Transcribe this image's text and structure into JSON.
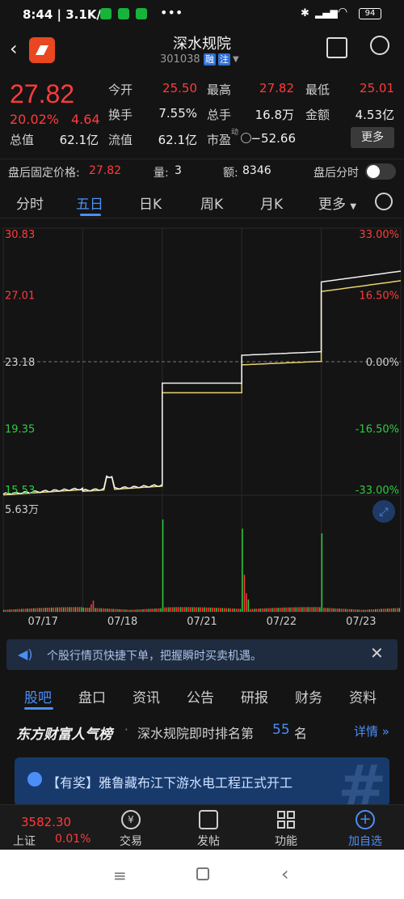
{
  "status": {
    "time": "8:44",
    "speed": "3.1K/s",
    "battery": "94"
  },
  "header": {
    "name": "深水规院",
    "code": "301038",
    "tag1": "融",
    "tag2": "注"
  },
  "quote": {
    "price": "27.82",
    "change_pct": "20.02%",
    "change": "4.64",
    "open_label": "今开",
    "open": "25.50",
    "high_label": "最高",
    "high": "27.82",
    "low_label": "最低",
    "low": "25.01",
    "turnover_label": "换手",
    "turnover": "7.55%",
    "volume_label": "总手",
    "volume": "16.8万",
    "amount_label": "金额",
    "amount": "4.53亿",
    "mcap_label": "总值",
    "mcap": "62.1亿",
    "float_label": "流值",
    "float": "62.1亿",
    "pe_label": "市盈",
    "pe_sup": "动",
    "pe": "−52.66",
    "more": "更多"
  },
  "post": {
    "price_label": "盘后固定价格:",
    "price": "27.82",
    "vol_label": "量:",
    "vol": "3",
    "amt_label": "额:",
    "amt": "8346",
    "toggle_label": "盘后分时"
  },
  "tabs": [
    "分时",
    "五日",
    "日K",
    "周K",
    "月K",
    "更多"
  ],
  "chart_data": {
    "type": "line",
    "y_left": [
      "30.83",
      "27.01",
      "23.18",
      "19.35",
      "15.53"
    ],
    "y_right": [
      "33.00%",
      "16.50%",
      "0.00%",
      "-16.50%",
      "-33.00%"
    ],
    "ylim": [
      15.53,
      30.83
    ],
    "volume_max_label": "5.63万",
    "x": [
      "07/17",
      "07/18",
      "07/21",
      "07/22",
      "07/23"
    ],
    "series": [
      {
        "values": [
          15.6,
          15.8,
          16.6,
          21.4,
          23.2,
          27.82
        ]
      }
    ]
  },
  "ad": {
    "text": "个股行情页快捷下单，把握瞬时买卖机遇。"
  },
  "bottom_tabs": [
    "股吧",
    "盘口",
    "资讯",
    "公告",
    "研报",
    "财务",
    "资料"
  ],
  "rank": {
    "brand": "东方财富人气榜",
    "text": "深水规院即时排名第",
    "num": "55",
    "unit": "名",
    "detail": "详情"
  },
  "news": {
    "text": "【有奖】雅鲁藏布江下游水电工程正式开工"
  },
  "toolbar": {
    "index_value": "3582.30",
    "index_name": "上证",
    "index_pct": "0.01%",
    "items": [
      "交易",
      "发帖",
      "功能",
      "加自选"
    ]
  }
}
